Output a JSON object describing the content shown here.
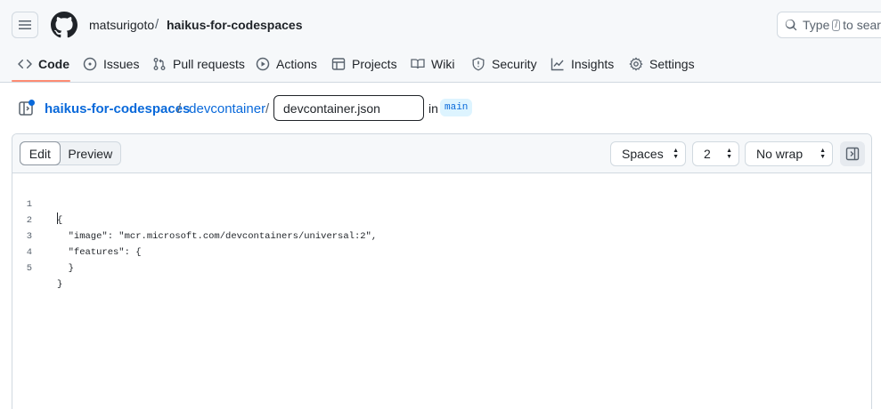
{
  "header": {
    "owner": "matsurigoto",
    "separator": "/",
    "repo": "haikus-for-codespaces",
    "search_placeholder_pre": "Type",
    "search_key": "/",
    "search_placeholder_post": "to search"
  },
  "tabs": [
    {
      "label": "Code",
      "icon": "code-icon",
      "active": true
    },
    {
      "label": "Issues",
      "icon": "issue-opened-icon"
    },
    {
      "label": "Pull requests",
      "icon": "git-pull-request-icon"
    },
    {
      "label": "Actions",
      "icon": "play-icon"
    },
    {
      "label": "Projects",
      "icon": "table-icon"
    },
    {
      "label": "Wiki",
      "icon": "book-icon"
    },
    {
      "label": "Security",
      "icon": "shield-icon"
    },
    {
      "label": "Insights",
      "icon": "graph-icon"
    },
    {
      "label": "Settings",
      "icon": "gear-icon"
    }
  ],
  "breadcrumb": {
    "repo": "haikus-for-codespaces",
    "sep": "/",
    "dir": ".devcontainer",
    "filename": "devcontainer.json",
    "in_label": "in",
    "branch": "main"
  },
  "editor": {
    "mode_edit": "Edit",
    "mode_preview": "Preview",
    "indent_mode": "Spaces",
    "indent_size": "2",
    "wrap_mode": "No wrap",
    "lines": [
      {
        "n": "1",
        "text": "{"
      },
      {
        "n": "2",
        "text": "  \"image\": \"mcr.microsoft.com/devcontainers/universal:2\","
      },
      {
        "n": "3",
        "text": "  \"features\": {"
      },
      {
        "n": "4",
        "text": "  }"
      },
      {
        "n": "5",
        "text": "}"
      }
    ]
  },
  "colors": {
    "accent_link": "#0969da",
    "tab_underline": "#fd8c73",
    "branch_bg": "#ddf4ff"
  }
}
